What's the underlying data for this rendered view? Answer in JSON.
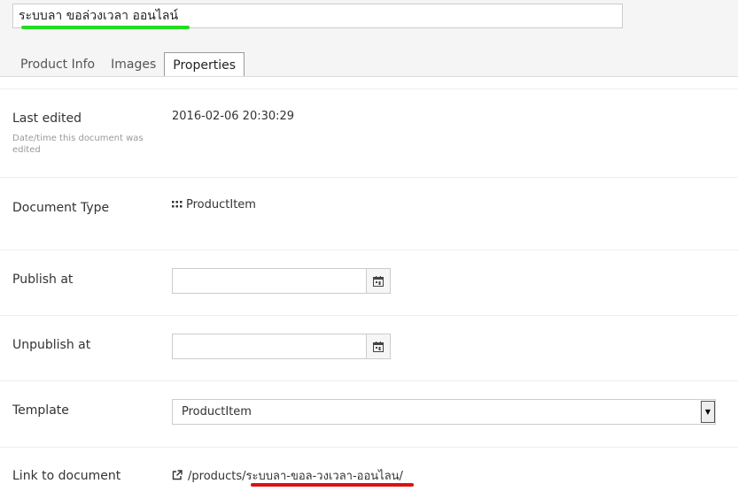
{
  "document": {
    "name": "ระบบลา ขอล่วงเวลา ออนไลน์"
  },
  "tabs": [
    {
      "label": "Product Info",
      "active": false
    },
    {
      "label": "Images",
      "active": false
    },
    {
      "label": "Properties",
      "active": true
    }
  ],
  "properties": {
    "last_edited": {
      "label": "Last edited",
      "description": "Date/time this document was edited",
      "value": "2016-02-06 20:30:29"
    },
    "document_type": {
      "label": "Document Type",
      "value": "ProductItem",
      "icon": "grid-icon"
    },
    "publish_at": {
      "label": "Publish at",
      "value": "",
      "icon": "calendar-icon"
    },
    "unpublish_at": {
      "label": "Unpublish at",
      "value": "",
      "icon": "calendar-icon"
    },
    "template": {
      "label": "Template",
      "value": "ProductItem"
    },
    "link_to_document": {
      "label": "Link to document",
      "value": "/products/ระบบลา-ขอล-วงเวลา-ออนไลน/",
      "icon": "external-link-icon"
    }
  },
  "colors": {
    "highlight_green": "#22dd22",
    "highlight_red": "#dd1111"
  }
}
